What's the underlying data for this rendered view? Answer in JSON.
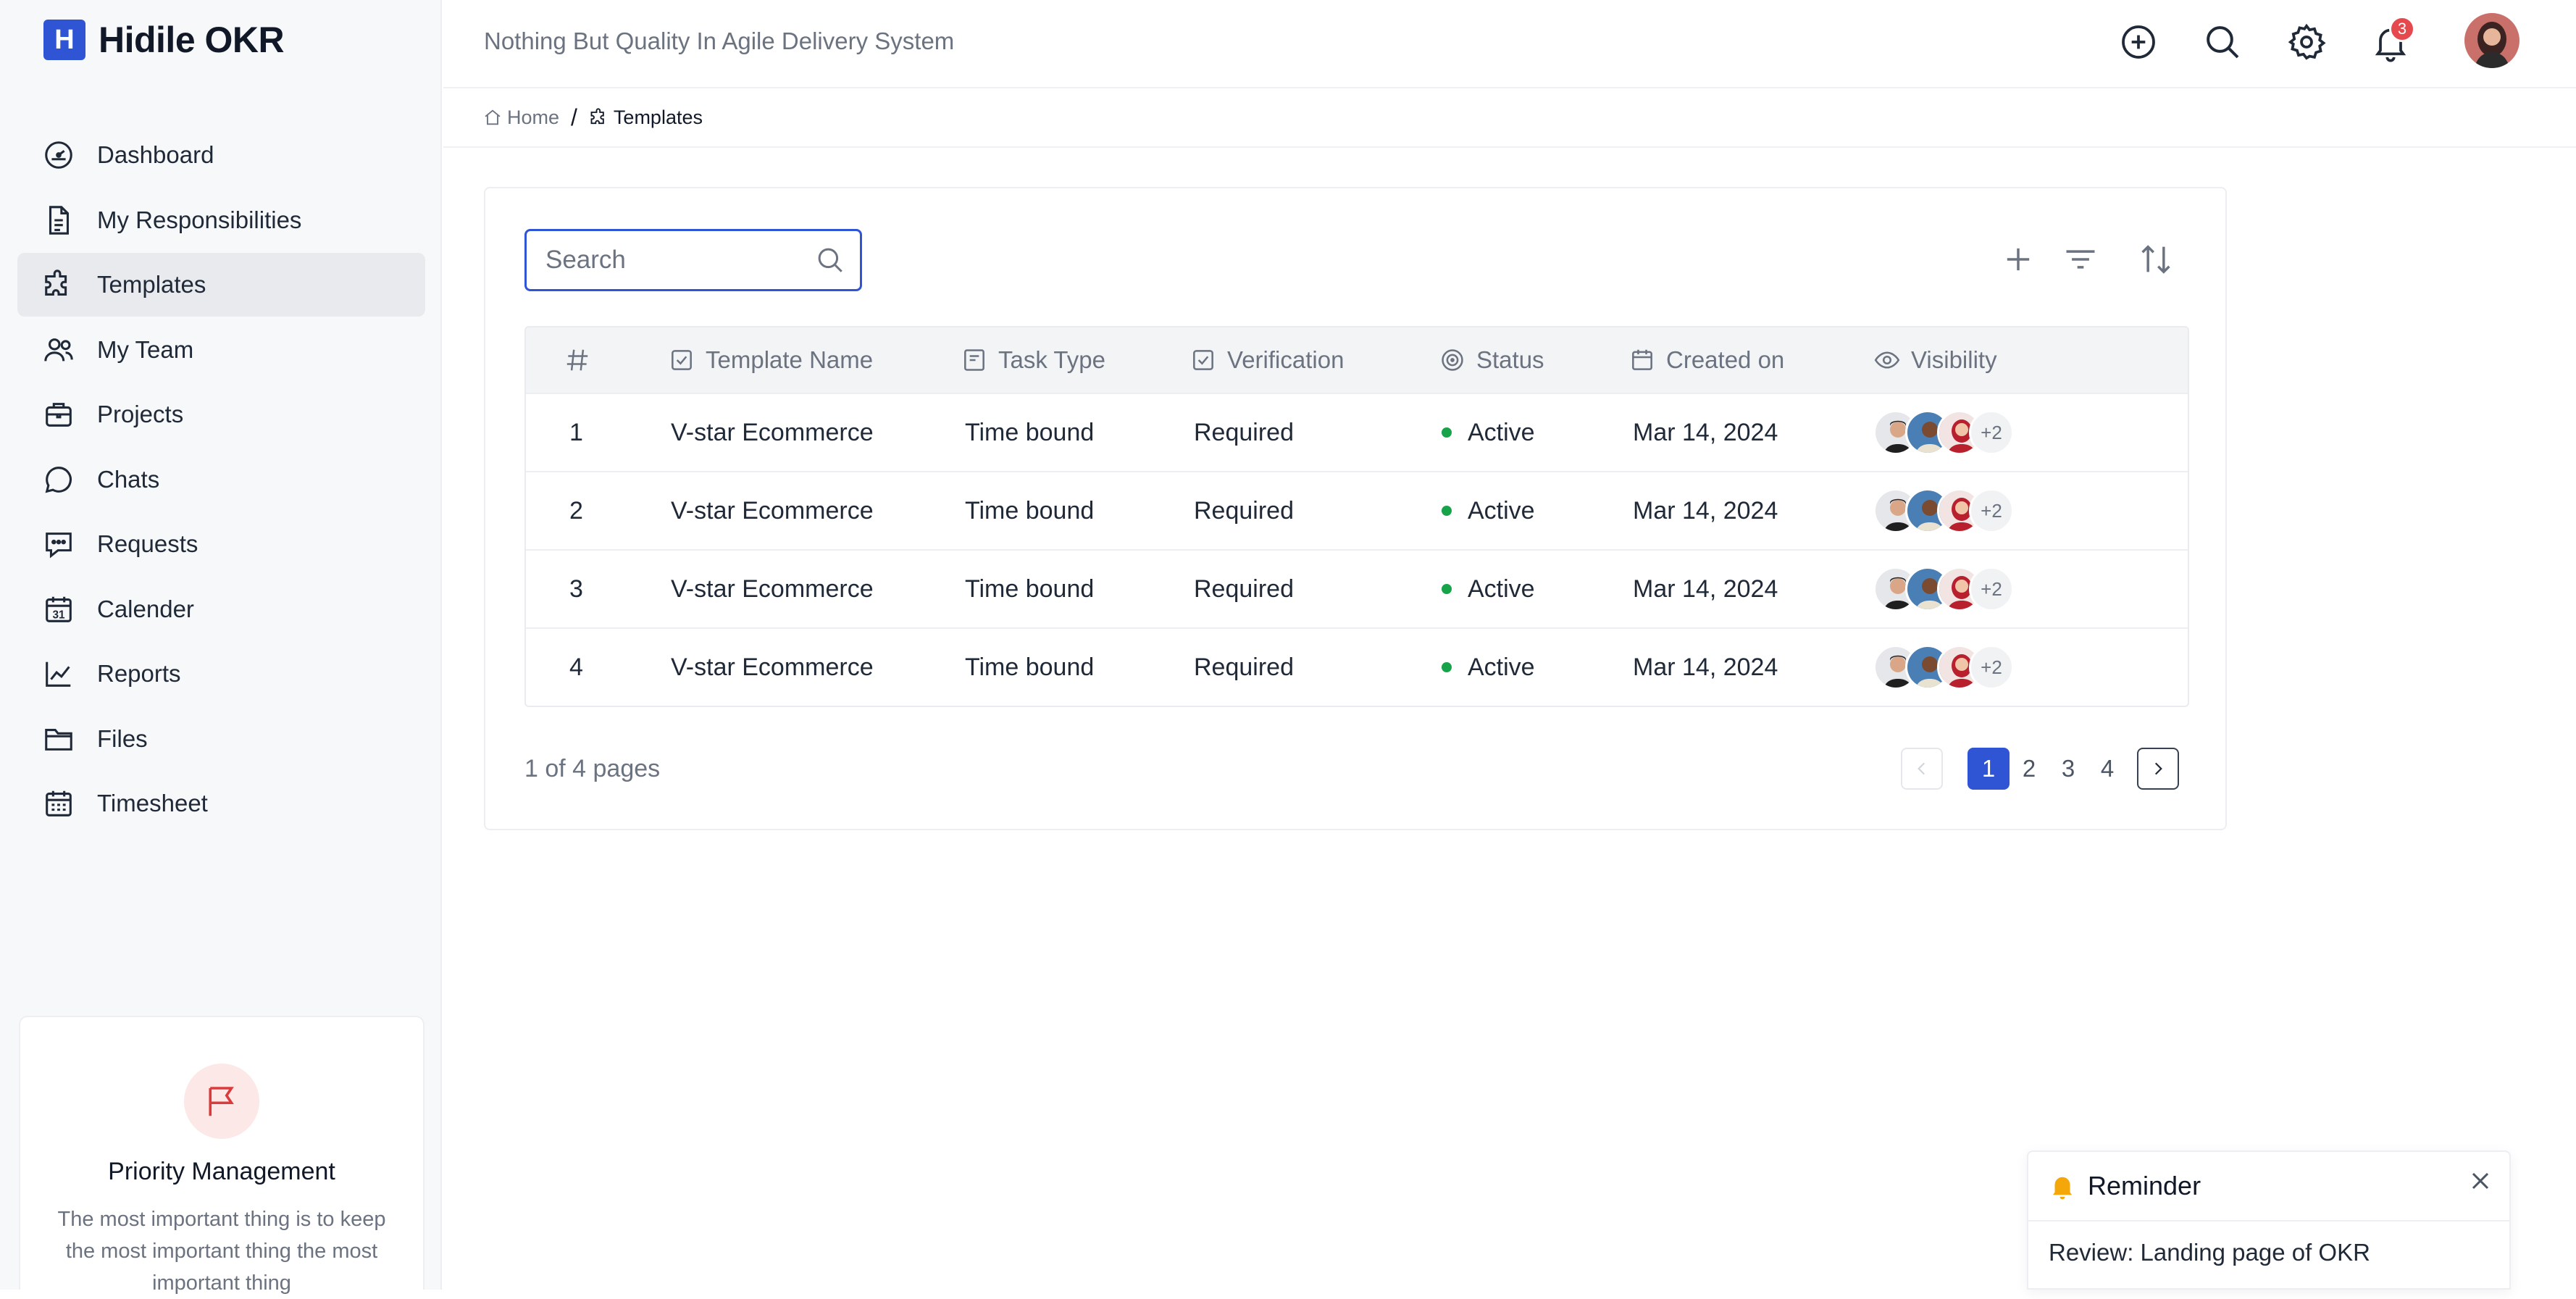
{
  "app": {
    "logo_letter": "H",
    "name": "Hidile OKR",
    "tagline": "Nothing But Quality In Agile Delivery System"
  },
  "colors": {
    "accent": "#2f55d4",
    "status_active": "#16a34a",
    "badge": "#e5484d",
    "promo_icon_bg": "#fde8e8"
  },
  "sidebar": {
    "items": [
      {
        "label": "Dashboard",
        "icon": "dashboard-icon"
      },
      {
        "label": "My Responsibilities",
        "icon": "document-icon"
      },
      {
        "label": "Templates",
        "icon": "puzzle-icon",
        "active": true
      },
      {
        "label": "My Team",
        "icon": "team-icon"
      },
      {
        "label": "Projects",
        "icon": "briefcase-icon"
      },
      {
        "label": "Chats",
        "icon": "chat-icon"
      },
      {
        "label": "Requests",
        "icon": "message-icon"
      },
      {
        "label": "Calender",
        "icon": "calendar-icon"
      },
      {
        "label": "Reports",
        "icon": "chart-icon"
      },
      {
        "label": "Files",
        "icon": "folder-icon"
      },
      {
        "label": "Timesheet",
        "icon": "timesheet-icon"
      }
    ],
    "promo": {
      "title": "Priority Management",
      "text": "The most important thing is to keep the most important thing the most important thing",
      "icon": "flag-icon"
    }
  },
  "topbar": {
    "notification_count": "3"
  },
  "breadcrumb": {
    "home": "Home",
    "separator": "/",
    "current": "Templates"
  },
  "toolbar": {
    "search_placeholder": "Search"
  },
  "table": {
    "headers": {
      "index": "#",
      "name": "Template Name",
      "task_type": "Task Type",
      "verification": "Verification",
      "status": "Status",
      "created": "Created on",
      "visibility": "Visibility"
    },
    "rows": [
      {
        "index": "1",
        "name": "V-star Ecommerce",
        "task_type": "Time bound",
        "verification": "Required",
        "status": "Active",
        "created": "Mar 14, 2024",
        "extra": "+2"
      },
      {
        "index": "2",
        "name": "V-star Ecommerce",
        "task_type": "Time bound",
        "verification": "Required",
        "status": "Active",
        "created": "Mar 14, 2024",
        "extra": "+2"
      },
      {
        "index": "3",
        "name": "V-star Ecommerce",
        "task_type": "Time bound",
        "verification": "Required",
        "status": "Active",
        "created": "Mar 14, 2024",
        "extra": "+2"
      },
      {
        "index": "4",
        "name": "V-star Ecommerce",
        "task_type": "Time bound",
        "verification": "Required",
        "status": "Active",
        "created": "Mar 14, 2024",
        "extra": "+2"
      }
    ]
  },
  "pagination": {
    "info": "1 of 4 pages",
    "pages": [
      "1",
      "2",
      "3",
      "4"
    ],
    "current": "1"
  },
  "reminder": {
    "title": "Reminder",
    "text": "Review: Landing page of OKR"
  }
}
